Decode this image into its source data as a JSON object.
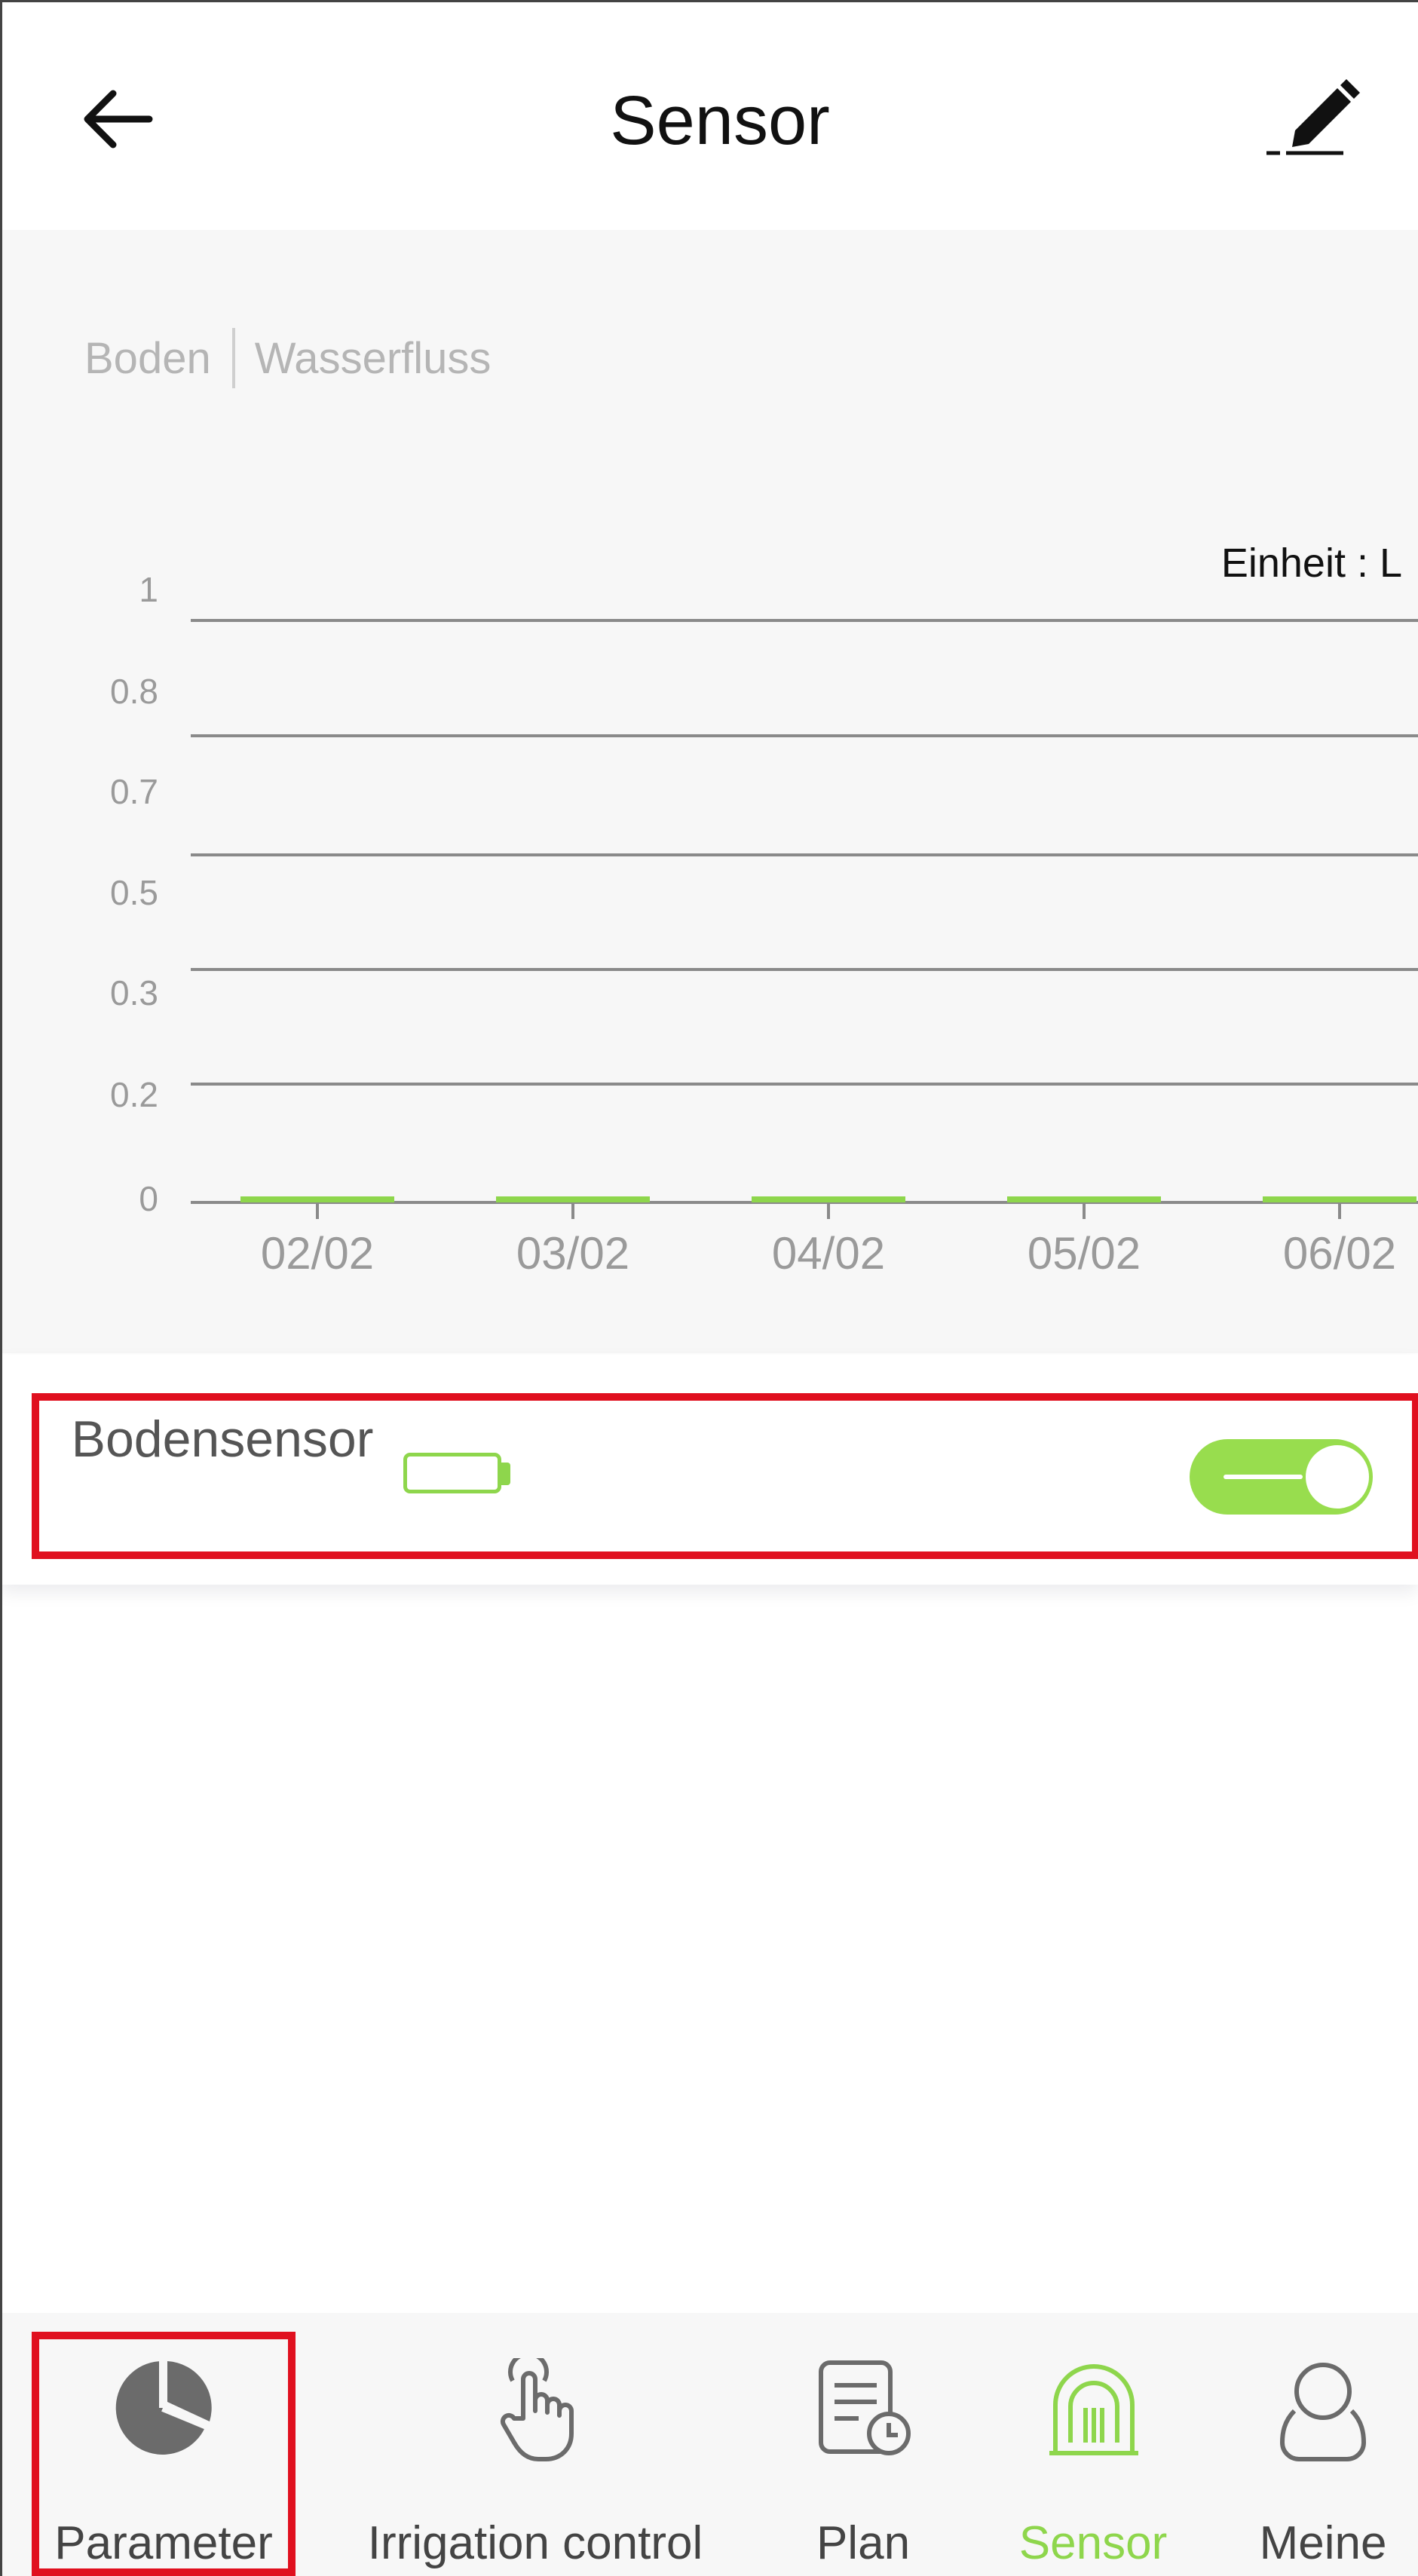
{
  "header": {
    "title": "Sensor"
  },
  "chart_tabs": {
    "soil": "Boden",
    "water_flow": "Wasserfluss"
  },
  "chart_data": {
    "type": "bar",
    "unit_label": "Einheit : L",
    "categories": [
      "02/02",
      "03/02",
      "04/02",
      "05/02",
      "06/02"
    ],
    "values": [
      0,
      0,
      0,
      0,
      0
    ],
    "y_ticks": [
      "1",
      "0.8",
      "0.7",
      "0.5",
      "0.3",
      "0.2",
      "0"
    ],
    "ylim": [
      0,
      1
    ],
    "grid": true,
    "bar_color": "#8ed64c"
  },
  "sensor": {
    "name": "Bodensensor",
    "toggle_on": true,
    "battery_color": "#8ed64c"
  },
  "nav": {
    "items": [
      {
        "label": "Parameter",
        "icon": "pie-chart-icon",
        "active": false
      },
      {
        "label": "Irrigation control",
        "icon": "touch-hand-icon",
        "active": false
      },
      {
        "label": "Plan",
        "icon": "schedule-document-icon",
        "active": false
      },
      {
        "label": "Sensor",
        "icon": "sensor-dome-icon",
        "active": true
      },
      {
        "label": "Meine",
        "icon": "user-icon",
        "active": false
      }
    ]
  },
  "colors": {
    "accent": "#8ed64c",
    "highlight": "#e0101f"
  }
}
